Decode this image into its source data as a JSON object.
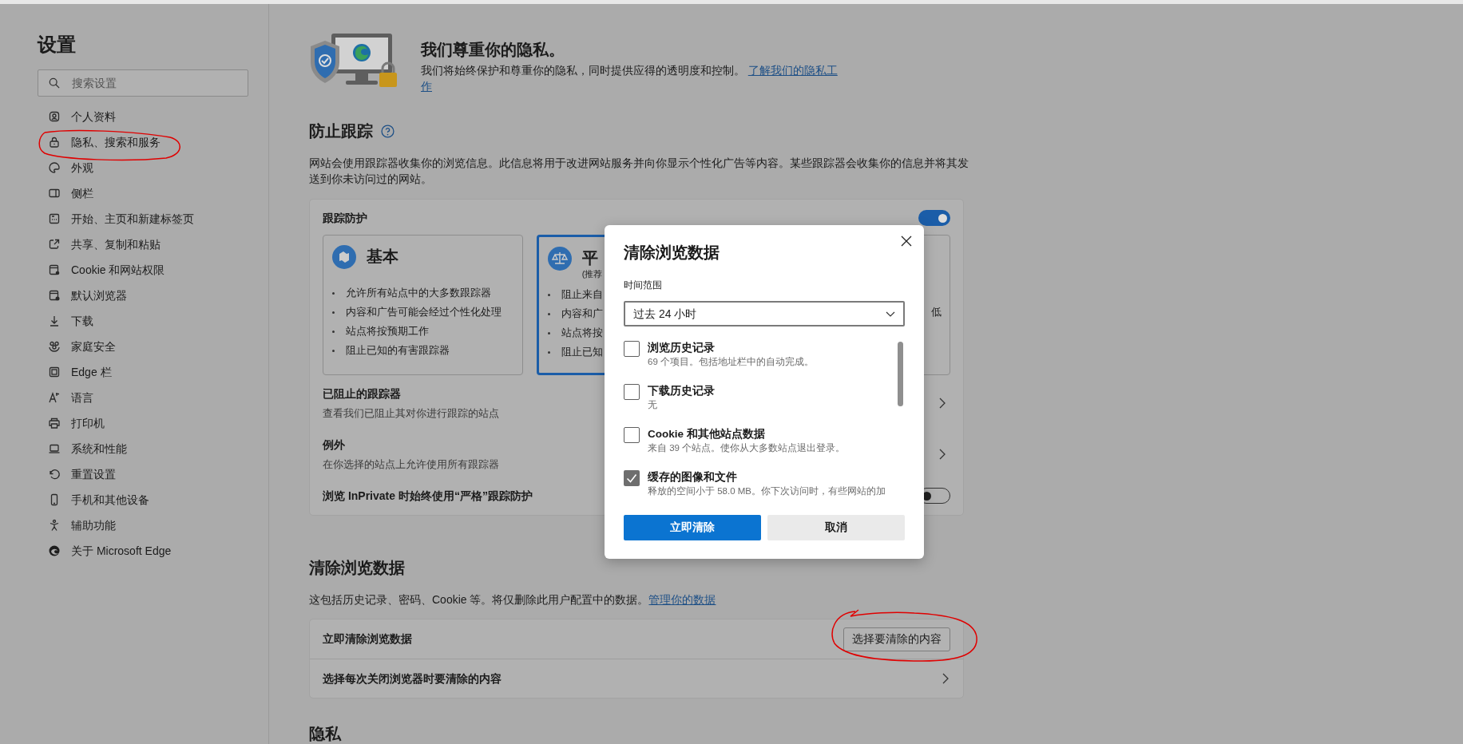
{
  "sidebar": {
    "title": "设置",
    "search": {
      "placeholder": "搜索设置"
    },
    "items": [
      {
        "label": "个人资料"
      },
      {
        "label": "隐私、搜索和服务"
      },
      {
        "label": "外观"
      },
      {
        "label": "侧栏"
      },
      {
        "label": "开始、主页和新建标签页"
      },
      {
        "label": "共享、复制和粘贴"
      },
      {
        "label": "Cookie 和网站权限"
      },
      {
        "label": "默认浏览器"
      },
      {
        "label": "下载"
      },
      {
        "label": "家庭安全"
      },
      {
        "label": "Edge 栏"
      },
      {
        "label": "语言"
      },
      {
        "label": "打印机"
      },
      {
        "label": "系统和性能"
      },
      {
        "label": "重置设置"
      },
      {
        "label": "手机和其他设备"
      },
      {
        "label": "辅助功能"
      },
      {
        "label": "关于 Microsoft Edge"
      }
    ]
  },
  "hero": {
    "title": "我们尊重你的隐私。",
    "text": "我们将始终保护和尊重你的隐私，同时提供应得的透明度和控制。",
    "link_lines": [
      "了解我们的隐私工",
      "作"
    ]
  },
  "tracking": {
    "heading": "防止跟踪",
    "description": "网站会使用跟踪器收集你的浏览信息。此信息将用于改进网站服务并向你显示个性化广告等内容。某些跟踪器会收集你的信息并将其发送到你未访问过的网站。",
    "card": {
      "title": "跟踪防护",
      "on": true,
      "levels": [
        {
          "title": "基本",
          "selected": false,
          "bullets": [
            "允许所有站点中的大多数跟踪器",
            "内容和广告可能会经过个性化处理",
            "站点将按预期工作",
            "阻止已知的有害跟踪器"
          ]
        },
        {
          "title": "平",
          "subtitle": "(推荐",
          "selected": true,
          "bullets": [
            "阻止来自",
            "内容和广",
            "站点将按",
            "阻止已知"
          ]
        },
        {
          "selected": false,
          "bullets": [
            "低"
          ]
        }
      ],
      "rows": [
        {
          "title": "已阻止的跟踪器",
          "subtitle": "查看我们已阻止其对你进行跟踪的站点"
        },
        {
          "title": "例外",
          "subtitle": "在你选择的站点上允许使用所有跟踪器"
        }
      ],
      "inprivate": {
        "label": "浏览 InPrivate 时始终使用“严格”跟踪防护",
        "on": false
      }
    }
  },
  "clear_data": {
    "heading": "清除浏览数据",
    "description": "这包括历史记录、密码、Cookie 等。将仅删除此用户配置中的数据。",
    "link": "管理你的数据",
    "rows": [
      {
        "kind": "button",
        "label": "立即清除浏览数据",
        "button": "选择要清除的内容"
      },
      {
        "kind": "link",
        "label": "选择每次关闭浏览器时要清除的内容"
      }
    ]
  },
  "privacy": {
    "heading": "隐私"
  },
  "dialog": {
    "title": "清除浏览数据",
    "range_label": "时间范围",
    "range_value": "过去 24 小时",
    "options": [
      {
        "label": "浏览历史记录",
        "detail": "69 个项目。包括地址栏中的自动完成。",
        "checked": false
      },
      {
        "label": "下载历史记录",
        "detail": "无",
        "checked": false
      },
      {
        "label": "Cookie 和其他站点数据",
        "detail": "来自 39 个站点。使你从大多数站点退出登录。",
        "checked": false
      },
      {
        "label": "缓存的图像和文件",
        "detail": "释放的空间小于 58.0 MB。你下次访问时，有些网站的加",
        "checked": true
      }
    ],
    "buttons": [
      {
        "label": "立即清除",
        "kind": "primary"
      },
      {
        "label": "取消",
        "kind": "secondary"
      }
    ]
  }
}
